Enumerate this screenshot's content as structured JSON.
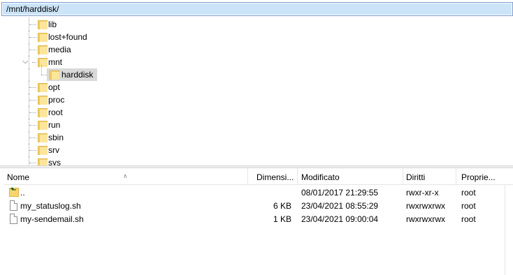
{
  "path_bar": {
    "value": "/mnt/harddisk/"
  },
  "tree": {
    "items": [
      {
        "label": "lib"
      },
      {
        "label": "lost+found"
      },
      {
        "label": "media"
      },
      {
        "label": "mnt"
      },
      {
        "label": "harddisk"
      },
      {
        "label": "opt"
      },
      {
        "label": "proc"
      },
      {
        "label": "root"
      },
      {
        "label": "run"
      },
      {
        "label": "sbin"
      },
      {
        "label": "srv"
      },
      {
        "label": "sys"
      }
    ]
  },
  "list": {
    "columns": {
      "name": "Nome",
      "size": "Dimensi...",
      "modified": "Modificato",
      "permissions": "Diritti",
      "owner": "Proprie..."
    },
    "rows": [
      {
        "name": "..",
        "size": "",
        "modified": "08/01/2017 21:29:55",
        "permissions": "rwxr-xr-x",
        "owner": "root"
      },
      {
        "name": "my_statuslog.sh",
        "size": "6 KB",
        "modified": "23/04/2021 08:55:29",
        "permissions": "rwxrwxrwx",
        "owner": "root"
      },
      {
        "name": "my-sendemail.sh",
        "size": "1 KB",
        "modified": "23/04/2021 09:00:04",
        "permissions": "rwxrwxrwx",
        "owner": "root"
      }
    ]
  }
}
